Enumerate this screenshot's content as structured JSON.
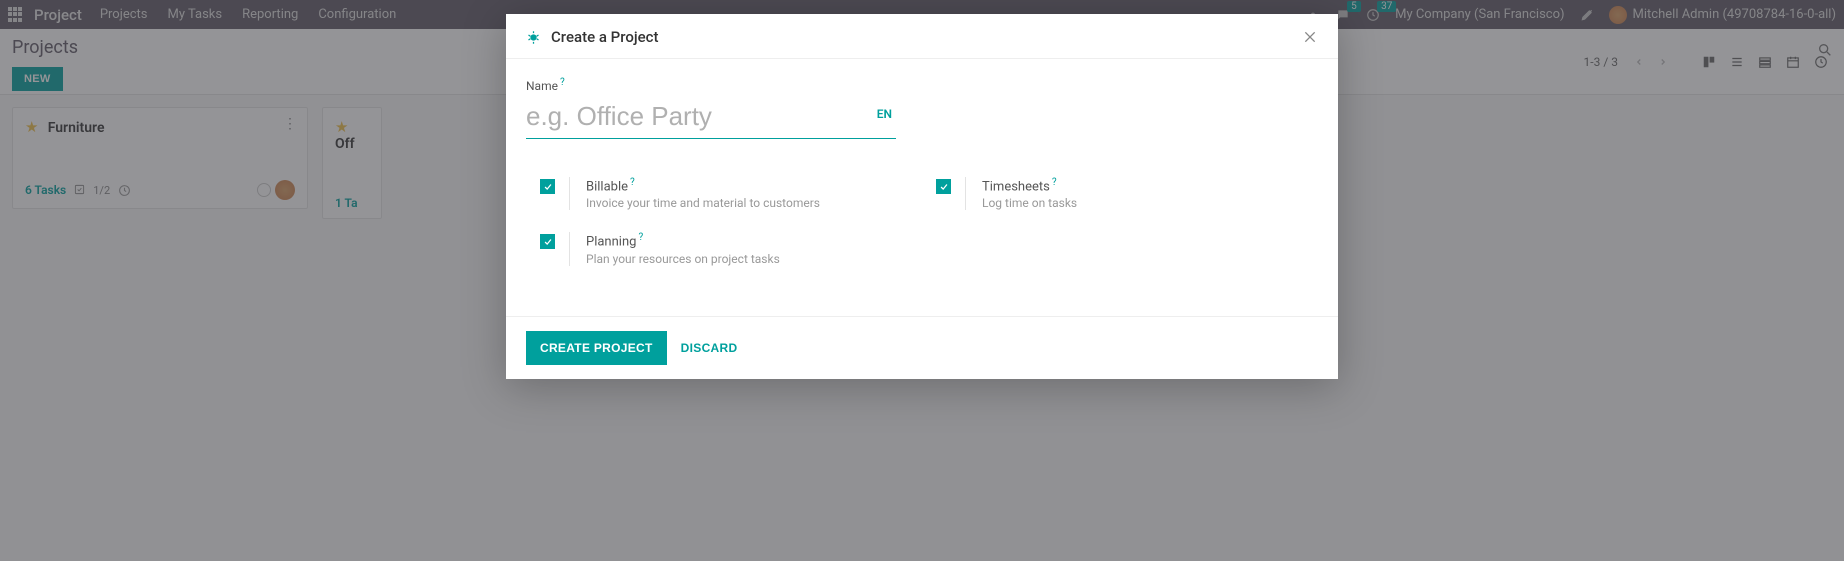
{
  "nav": {
    "brand": "Project",
    "menu": [
      "Projects",
      "My Tasks",
      "Reporting",
      "Configuration"
    ],
    "messages_badge": "5",
    "activities_badge": "37",
    "company": "My Company (San Francisco)",
    "user": "Mitchell Admin (49708784-16-0-all)"
  },
  "cp": {
    "breadcrumb": "Projects",
    "new_btn": "NEW",
    "pager": "1-3 / 3"
  },
  "kanban": {
    "cards": [
      {
        "title": "Furniture",
        "tasks_label": "6 Tasks",
        "progress": "1/2"
      },
      {
        "title": "Off",
        "tasks_label": "1 Ta"
      }
    ]
  },
  "modal": {
    "title": "Create a Project",
    "name_label": "Name",
    "name_placeholder": "e.g. Office Party",
    "lang": "EN",
    "options": [
      {
        "label": "Billable",
        "desc": "Invoice your time and material to customers",
        "checked": true
      },
      {
        "label": "Planning",
        "desc": "Plan your resources on project tasks",
        "checked": true
      },
      {
        "label": "Timesheets",
        "desc": "Log time on tasks",
        "checked": true
      }
    ],
    "primary_btn": "CREATE PROJECT",
    "secondary_btn": "DISCARD"
  }
}
